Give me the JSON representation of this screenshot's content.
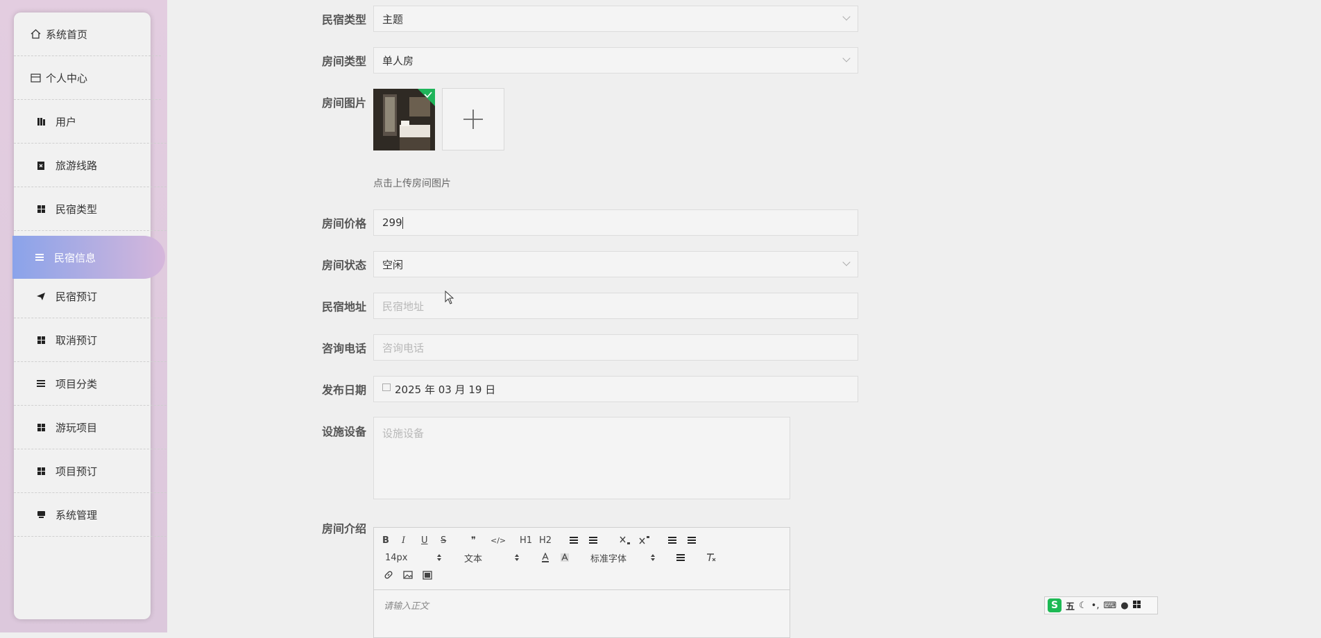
{
  "sidebar": {
    "items": [
      {
        "label": "系统首页",
        "icon": "home-icon"
      },
      {
        "label": "个人中心",
        "icon": "card-icon"
      },
      {
        "label": "用户",
        "icon": "book-icon"
      },
      {
        "label": "旅游线路",
        "icon": "clipboard-icon"
      },
      {
        "label": "民宿类型",
        "icon": "grid-icon"
      },
      {
        "label": "民宿信息",
        "icon": "list-icon",
        "active": true
      },
      {
        "label": "民宿预订",
        "icon": "send-icon"
      },
      {
        "label": "取消预订",
        "icon": "grid-icon"
      },
      {
        "label": "项目分类",
        "icon": "list-icon"
      },
      {
        "label": "游玩项目",
        "icon": "grid-icon"
      },
      {
        "label": "项目预订",
        "icon": "grid-icon"
      },
      {
        "label": "系统管理",
        "icon": "desktop-icon"
      }
    ]
  },
  "form": {
    "homestay_type": {
      "label": "民宿类型",
      "value": "主题"
    },
    "room_type": {
      "label": "房间类型",
      "value": "单人房"
    },
    "room_image": {
      "label": "房间图片",
      "hint": "点击上传房间图片"
    },
    "room_price": {
      "label": "房间价格",
      "value": "299"
    },
    "room_status": {
      "label": "房间状态",
      "value": "空闲"
    },
    "address": {
      "label": "民宿地址",
      "placeholder": "民宿地址"
    },
    "phone": {
      "label": "咨询电话",
      "placeholder": "咨询电话"
    },
    "publish_date": {
      "label": "发布日期",
      "value": "2025 年 03 月 19 日"
    },
    "facilities": {
      "label": "设施设备",
      "placeholder": "设施设备"
    },
    "intro": {
      "label": "房间介绍",
      "placeholder": "请输入正文"
    }
  },
  "editor_toolbar": {
    "font_size": "14px",
    "text_style": "文本",
    "font_family": "标准字体",
    "buttons": [
      "B",
      "I",
      "U",
      "S",
      "❞",
      "</>",
      "H1",
      "H2"
    ]
  },
  "ime": {
    "char": "五"
  }
}
